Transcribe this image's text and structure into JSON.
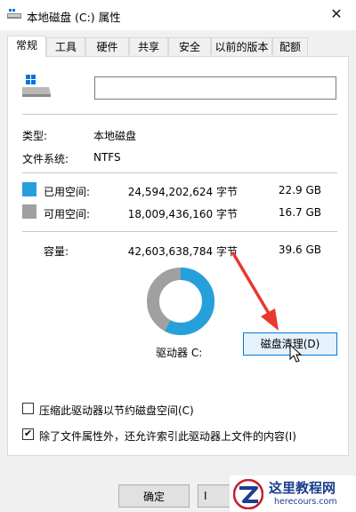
{
  "window": {
    "title": "本地磁盘 (C:) 属性",
    "close_glyph": "✕"
  },
  "tabs": [
    {
      "label": "常规",
      "active": true
    },
    {
      "label": "工具"
    },
    {
      "label": "硬件"
    },
    {
      "label": "共享"
    },
    {
      "label": "安全"
    },
    {
      "label": "以前的版本"
    },
    {
      "label": "配额"
    }
  ],
  "general": {
    "name_value": "",
    "type_label": "类型:",
    "type_value": "本地磁盘",
    "fs_label": "文件系统:",
    "fs_value": "NTFS",
    "used": {
      "label": "已用空间:",
      "bytes": "24,594,202,624 字节",
      "size": "22.9 GB",
      "color": "#26a0da"
    },
    "free": {
      "label": "可用空间:",
      "bytes": "18,009,436,160 字节",
      "size": "16.7 GB",
      "color": "#a0a0a0"
    },
    "capacity": {
      "label": "容量:",
      "bytes": "42,603,638,784 字节",
      "size": "39.6 GB"
    },
    "drive_label": "驱动器 C:",
    "cleanup_button": "磁盘清理(D)",
    "used_fraction": 0.577
  },
  "options": {
    "compress_label": "压缩此驱动器以节约磁盘空间(C)",
    "compress_checked": false,
    "index_label": "除了文件属性外，还允许索引此驱动器上文件的内容(I)",
    "index_checked": true
  },
  "buttons": {
    "ok": "确定",
    "second": "I"
  },
  "watermark": {
    "title": "这里教程网",
    "subtitle": "herecours.com"
  },
  "colors": {
    "accent": "#0078d7",
    "arrow": "#e8382f",
    "used": "#26a0da",
    "free": "#a0a0a0"
  },
  "icons": {
    "title": "drive-icon",
    "close": "close-icon",
    "drive": "windows-drive-icon",
    "cursor": "mouse-cursor-icon"
  }
}
